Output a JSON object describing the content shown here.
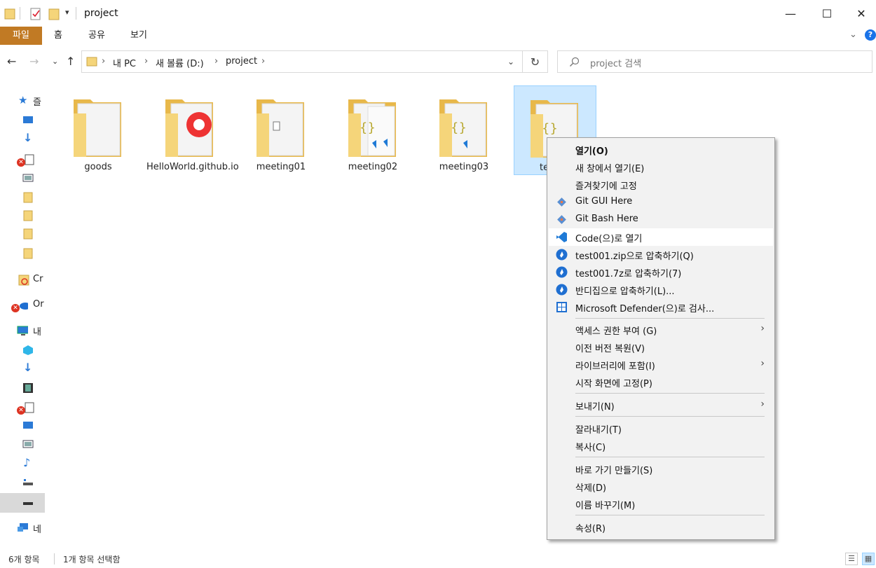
{
  "window": {
    "title": "project",
    "minimize": "—",
    "maximize": "☐",
    "close": "✕"
  },
  "ribbon": {
    "tabs": [
      "파일",
      "홈",
      "공유",
      "보기"
    ]
  },
  "address": {
    "crumbs": [
      "내 PC",
      "새 볼륨 (D:)",
      "project"
    ],
    "search_placeholder": "project 검색"
  },
  "sidebar": {
    "items": [
      "즐",
      "",
      "",
      "",
      "",
      "",
      "",
      "",
      "Cr",
      "Or",
      "내",
      "",
      "",
      "",
      "",
      "",
      "",
      "",
      "",
      "",
      "네"
    ]
  },
  "files": [
    {
      "name": "goods",
      "type": "plain"
    },
    {
      "name": "HelloWorld.github.io",
      "type": "chrome"
    },
    {
      "name": "meeting01",
      "type": "doc"
    },
    {
      "name": "meeting02",
      "type": "code"
    },
    {
      "name": "meeting03",
      "type": "code"
    },
    {
      "name": "te",
      "type": "code",
      "selected": true
    }
  ],
  "context_menu": {
    "items": [
      {
        "label": "열기(O)",
        "bold": true
      },
      {
        "label": "새 창에서 열기(E)"
      },
      {
        "label": "즐겨찾기에 고정"
      },
      {
        "label": "Git GUI Here",
        "icon": "git-icon"
      },
      {
        "label": "Git Bash Here",
        "icon": "git-icon"
      },
      {
        "label": "Code(으)로 열기",
        "icon": "vscode-icon",
        "highlighted": true
      },
      {
        "label": "test001.zip으로 압축하기(Q)",
        "icon": "bandizip-icon"
      },
      {
        "label": "test001.7z로 압축하기(7)",
        "icon": "bandizip-icon"
      },
      {
        "label": "반디집으로 압축하기(L)...",
        "icon": "bandizip-icon"
      },
      {
        "label": "Microsoft Defender(으)로 검사...",
        "icon": "defender-icon"
      },
      {
        "label": "액세스 권한 부여 (G)",
        "submenu": true
      },
      {
        "label": "이전 버전 복원(V)"
      },
      {
        "label": "라이브러리에 포함(I)",
        "submenu": true
      },
      {
        "label": "시작 화면에 고정(P)"
      },
      {
        "label": "보내기(N)",
        "submenu": true
      },
      {
        "label": "잘라내기(T)"
      },
      {
        "label": "복사(C)"
      },
      {
        "label": "바로 가기 만들기(S)"
      },
      {
        "label": "삭제(D)"
      },
      {
        "label": "이름 바꾸기(M)"
      },
      {
        "label": "속성(R)"
      }
    ]
  },
  "status": {
    "count": "6개 항목",
    "selected": "1개 항목 선택함"
  },
  "colors": {
    "file_tab": "#c17a24",
    "folder": "#f5d57a",
    "selection": "#cce8ff",
    "help": "#1a73e8"
  }
}
